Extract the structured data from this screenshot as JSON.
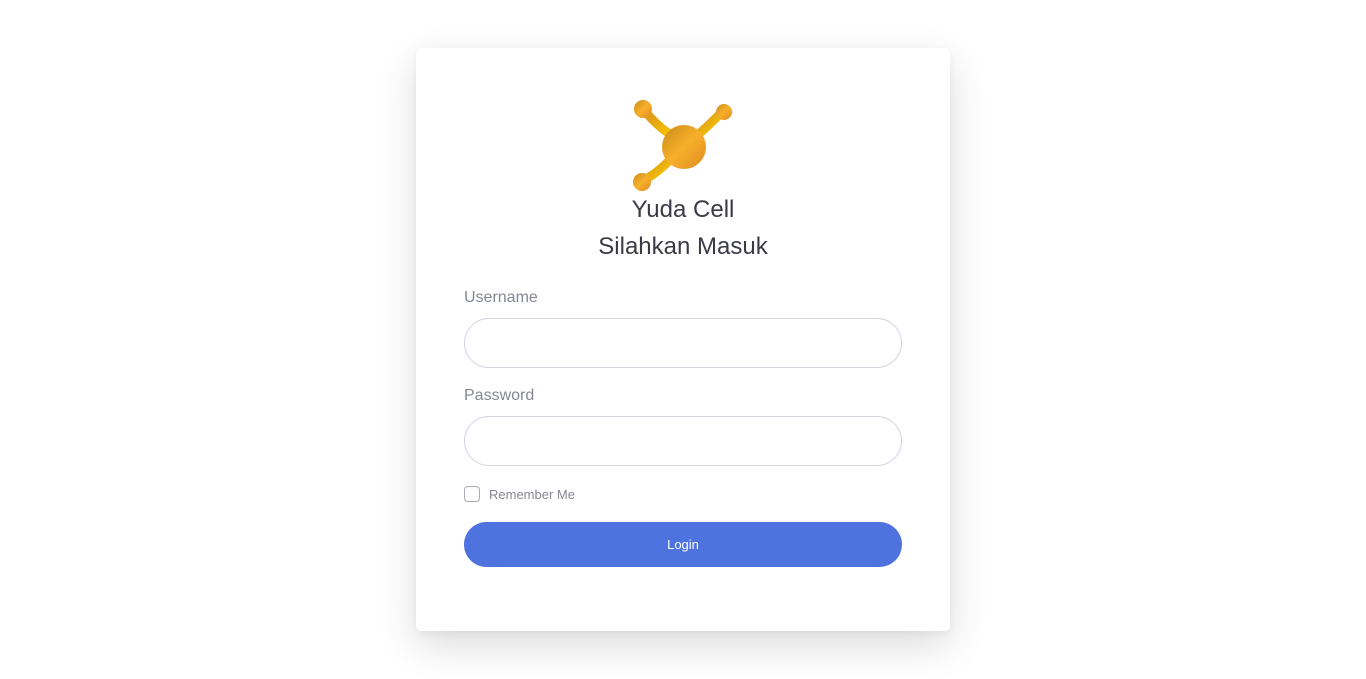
{
  "brand": {
    "name": "Yuda Cell",
    "logo_icon": "molecule-logo-icon",
    "logo_colors": [
      "#f5b21b",
      "#e8962a",
      "#ffd000"
    ]
  },
  "form": {
    "title": "Silahkan Masuk",
    "username": {
      "label": "Username",
      "value": "",
      "placeholder": ""
    },
    "password": {
      "label": "Password",
      "value": "",
      "placeholder": ""
    },
    "remember": {
      "label": "Remember Me",
      "checked": false
    },
    "submit_label": "Login"
  },
  "colors": {
    "primary": "#4e73df",
    "text": "#3a3b45",
    "muted": "#858796",
    "border": "#d1d3e2"
  }
}
